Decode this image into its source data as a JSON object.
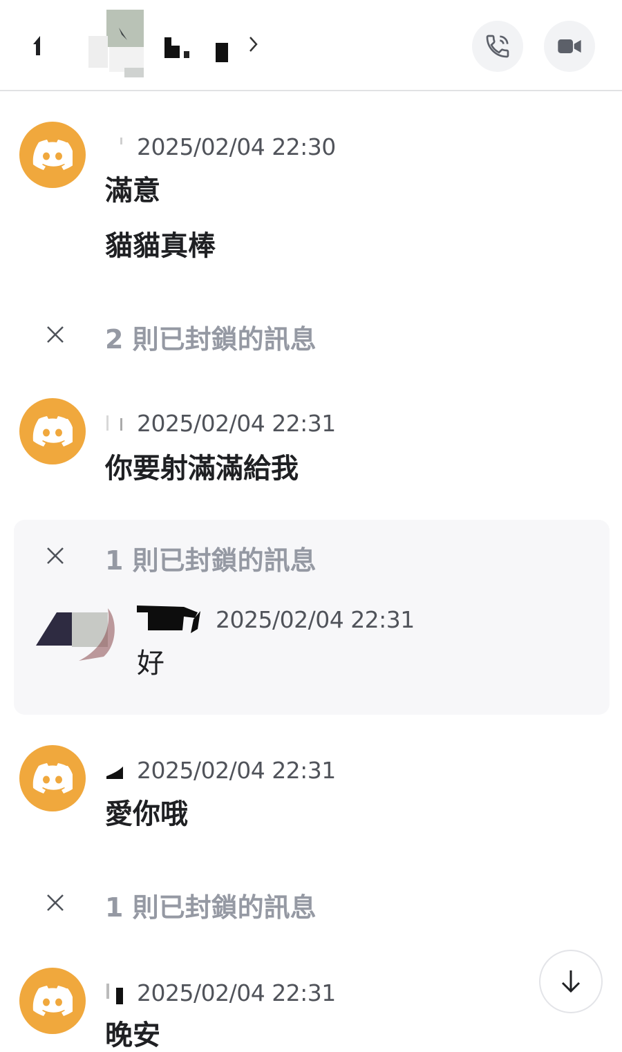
{
  "colors": {
    "discord_avatar": "#f0a83d",
    "blocked_text": "#9599a3",
    "timestamp": "#50535a",
    "expanded_bg": "#f7f7f9"
  },
  "header": {
    "back_icon": "arrow-left-icon",
    "call_icon": "phone-call-icon",
    "video_icon": "video-camera-icon"
  },
  "messages": [
    {
      "timestamp": "2025/02/04 22:30",
      "lines": [
        "滿意",
        "貓貓真棒"
      ]
    },
    {
      "blocked": "2 則已封鎖的訊息"
    },
    {
      "timestamp": "2025/02/04 22:31",
      "lines": [
        "你要射滿滿給我"
      ]
    },
    {
      "blocked": "1 則已封鎖的訊息",
      "expanded_message": {
        "timestamp": "2025/02/04 22:31",
        "text": "好"
      }
    },
    {
      "timestamp": "2025/02/04 22:31",
      "lines": [
        "愛你哦"
      ]
    },
    {
      "blocked": "1 則已封鎖的訊息"
    },
    {
      "timestamp": "2025/02/04 22:31",
      "lines": [
        "晚安"
      ]
    }
  ],
  "scroll_icon": "arrow-down-icon"
}
